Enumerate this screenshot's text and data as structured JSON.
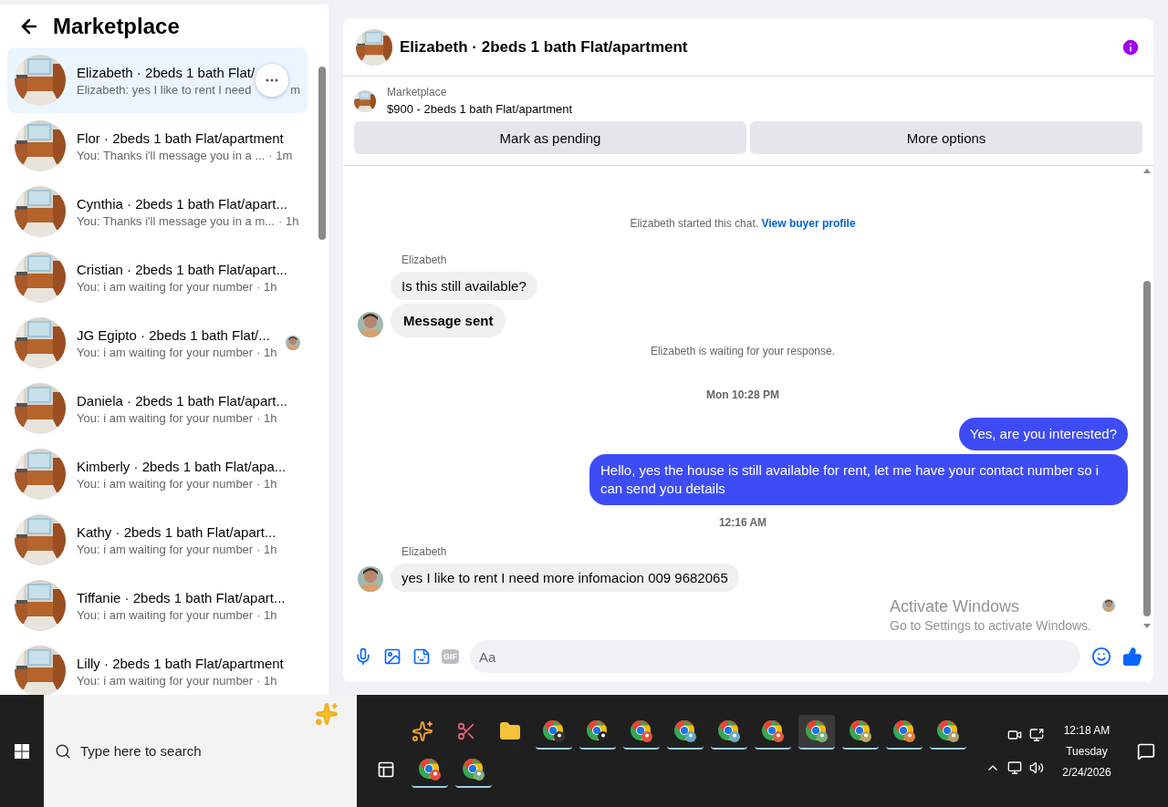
{
  "sidebar": {
    "title": "Marketplace",
    "conversations": [
      {
        "title": "Elizabeth · 2beds 1 bath Flat/",
        "preview": "Elizabeth: yes I like to rent I need",
        "time": "m",
        "selected": true,
        "hovered": true,
        "seen": false
      },
      {
        "title": "Flor · 2beds 1 bath Flat/apartment",
        "preview": "You: Thanks i'll message you in a ...",
        "time": "· 1m",
        "selected": false,
        "hovered": false,
        "seen": false
      },
      {
        "title": "Cynthia · 2beds 1 bath Flat/apart...",
        "preview": "You: Thanks i'll message you in a m...",
        "time": "· 1h",
        "selected": false,
        "hovered": false,
        "seen": false
      },
      {
        "title": "Cristian · 2beds 1 bath Flat/apart...",
        "preview": "You: i am waiting for your number",
        "time": "· 1h",
        "selected": false,
        "hovered": false,
        "seen": false
      },
      {
        "title": "JG Egipto · 2beds 1 bath Flat/...",
        "preview": "You: i am waiting for your number",
        "time": "· 1h",
        "selected": false,
        "hovered": false,
        "seen": true
      },
      {
        "title": "Daniela · 2beds 1 bath Flat/apart...",
        "preview": "You: i am waiting for your number",
        "time": "· 1h",
        "selected": false,
        "hovered": false,
        "seen": false
      },
      {
        "title": "Kimberly · 2beds 1 bath Flat/apa...",
        "preview": "You: i am waiting for your number",
        "time": "· 1h",
        "selected": false,
        "hovered": false,
        "seen": false
      },
      {
        "title": "Kathy · 2beds 1 bath Flat/apart...",
        "preview": "You: i am waiting for your number",
        "time": "· 1h",
        "selected": false,
        "hovered": false,
        "seen": false
      },
      {
        "title": "Tiffanie · 2beds 1 bath Flat/apart...",
        "preview": "You: i am waiting for your number",
        "time": "· 1h",
        "selected": false,
        "hovered": false,
        "seen": false
      },
      {
        "title": "Lilly · 2beds 1 bath Flat/apartment",
        "preview": "You: i am waiting for your number",
        "time": "· 1h",
        "selected": false,
        "hovered": false,
        "seen": false
      }
    ]
  },
  "chat": {
    "title": "Elizabeth · 2beds 1 bath Flat/apartment",
    "listing": {
      "label": "Marketplace",
      "title": "$900 - 2beds 1 bath Flat/apartment"
    },
    "buttons": [
      "Mark as pending",
      "More options"
    ],
    "messages": [
      {
        "kind": "notice",
        "text": "Elizabeth started this chat.",
        "link": "View buyer profile"
      },
      {
        "kind": "sender",
        "text": "Elizabeth"
      },
      {
        "kind": "in",
        "text": "Is this still available?",
        "avatar": false,
        "strong": false
      },
      {
        "kind": "in",
        "text": "Message sent",
        "avatar": true,
        "strong": true
      },
      {
        "kind": "notice",
        "text": "Elizabeth is waiting for your response."
      },
      {
        "kind": "time",
        "text": "Mon 10:28 PM"
      },
      {
        "kind": "out",
        "text": "Yes, are you interested?"
      },
      {
        "kind": "out",
        "text": "Hello, yes the house is still available for rent, let me have your contact number so i can send you details"
      },
      {
        "kind": "time",
        "text": "12:16 AM"
      },
      {
        "kind": "sender",
        "text": "Elizabeth"
      },
      {
        "kind": "in",
        "text": "yes I like to rent I need more infomacion 009 9682065",
        "avatar": true,
        "strong": false
      },
      {
        "kind": "seen"
      }
    ],
    "composer": {
      "gif": "GIF",
      "placeholder": "Aa"
    }
  },
  "activation": {
    "title": "Activate Windows",
    "subtitle": "Go to Settings to activate Windows."
  },
  "taskbar": {
    "search_placeholder": "Type here to search",
    "app_rows": [
      [
        {
          "kind": "copilot"
        },
        {
          "kind": "snip"
        },
        {
          "kind": "folder"
        },
        {
          "kind": "browser",
          "color": "#333333",
          "selected": false
        },
        {
          "kind": "browser",
          "color": "#222222",
          "selected": false
        },
        {
          "kind": "browser",
          "color": "#e0533f",
          "selected": false
        },
        {
          "kind": "browser",
          "color": "#5fa8c8",
          "selected": false
        },
        {
          "kind": "browser",
          "color": "#6ab0c0",
          "selected": false
        },
        {
          "kind": "browser",
          "color": "#e06040",
          "selected": false
        },
        {
          "kind": "browser",
          "color": "#7ab080",
          "selected": true
        },
        {
          "kind": "browser",
          "color": "#b8a860",
          "selected": false
        },
        {
          "kind": "browser",
          "color": "#e08040",
          "selected": false
        },
        {
          "kind": "browser",
          "color": "#b0a070",
          "selected": false
        }
      ],
      [
        {
          "kind": "taskview"
        },
        {
          "kind": "browser",
          "color": "#e05040",
          "selected": false
        },
        {
          "kind": "browser",
          "color": "#80b080",
          "selected": false
        }
      ]
    ],
    "clock": {
      "time": "12:18 AM",
      "day": "Tuesday",
      "date": "2/24/2026"
    }
  }
}
